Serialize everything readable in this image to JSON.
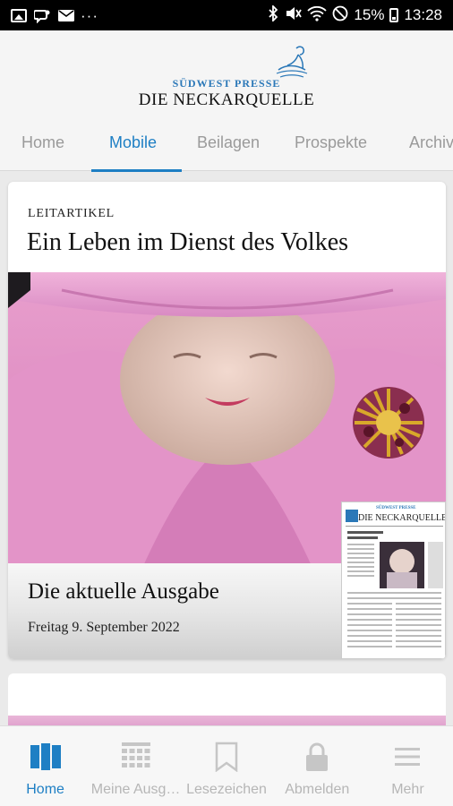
{
  "status_bar": {
    "battery": "15%",
    "time": "13:28",
    "dots": "···"
  },
  "header": {
    "logo_top": "SÜDWEST PRESSE",
    "logo_main": "DIE NECKARQUELLE"
  },
  "tabs": [
    {
      "label": "Home",
      "active": false
    },
    {
      "label": "Mobile",
      "active": true
    },
    {
      "label": "Beilagen",
      "active": false
    },
    {
      "label": "Prospekte",
      "active": false
    },
    {
      "label": "Archiv",
      "active": false
    }
  ],
  "card": {
    "kicker": "LEITARTIKEL",
    "headline": "Ein Leben im Dienst des Volkes",
    "caption_title": "Die aktuelle Ausgabe",
    "caption_date": "Freitag 9. September 2022",
    "paper_title": "DIE NECKARQUELLE",
    "paper_sub": "SÜDWEST PRESSE"
  },
  "bottom_nav": [
    {
      "label": "Home",
      "icon": "newspapers-icon",
      "active": true
    },
    {
      "label": "Meine Ausgaben",
      "icon": "grid-icon",
      "active": false
    },
    {
      "label": "Lesezeichen",
      "icon": "bookmark-icon",
      "active": false
    },
    {
      "label": "Abmelden",
      "icon": "lock-icon",
      "active": false
    },
    {
      "label": "Mehr",
      "icon": "menu-icon",
      "active": false
    }
  ],
  "colors": {
    "accent": "#1e7fc4",
    "inactive": "#b6b6b6",
    "brand_blue": "#2b78b8"
  }
}
